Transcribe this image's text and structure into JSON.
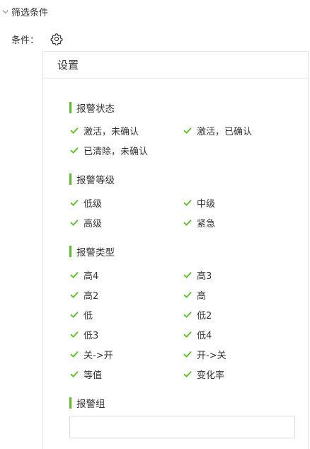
{
  "filter": {
    "title": "筛选条件",
    "expand_icon": "chevron-down-icon"
  },
  "condition": {
    "label": "条件：",
    "icon": "gear-icon"
  },
  "settings": {
    "title": "设置",
    "accent_color": "#52c41a",
    "alarm_state": {
      "title": "报警状态",
      "options": [
        {
          "label": "激活，未确认",
          "checked": true
        },
        {
          "label": "激活，已确认",
          "checked": true
        },
        {
          "label": "已清除，未确认",
          "checked": true
        }
      ]
    },
    "alarm_level": {
      "title": "报警等级",
      "options": [
        {
          "label": "低级",
          "checked": true
        },
        {
          "label": "中级",
          "checked": true
        },
        {
          "label": "高级",
          "checked": true
        },
        {
          "label": "紧急",
          "checked": true
        }
      ]
    },
    "alarm_type": {
      "title": "报警类型",
      "options": [
        {
          "label": "高4",
          "checked": true
        },
        {
          "label": "高3",
          "checked": true
        },
        {
          "label": "高2",
          "checked": true
        },
        {
          "label": "高",
          "checked": true
        },
        {
          "label": "低",
          "checked": true
        },
        {
          "label": "低2",
          "checked": true
        },
        {
          "label": "低3",
          "checked": true
        },
        {
          "label": "低4",
          "checked": true
        },
        {
          "label": "关->开",
          "checked": true
        },
        {
          "label": "开->关",
          "checked": true
        },
        {
          "label": "等值",
          "checked": true
        },
        {
          "label": "变化率",
          "checked": true
        }
      ]
    },
    "alarm_group": {
      "title": "报警组",
      "value": "",
      "placeholder": ""
    }
  }
}
